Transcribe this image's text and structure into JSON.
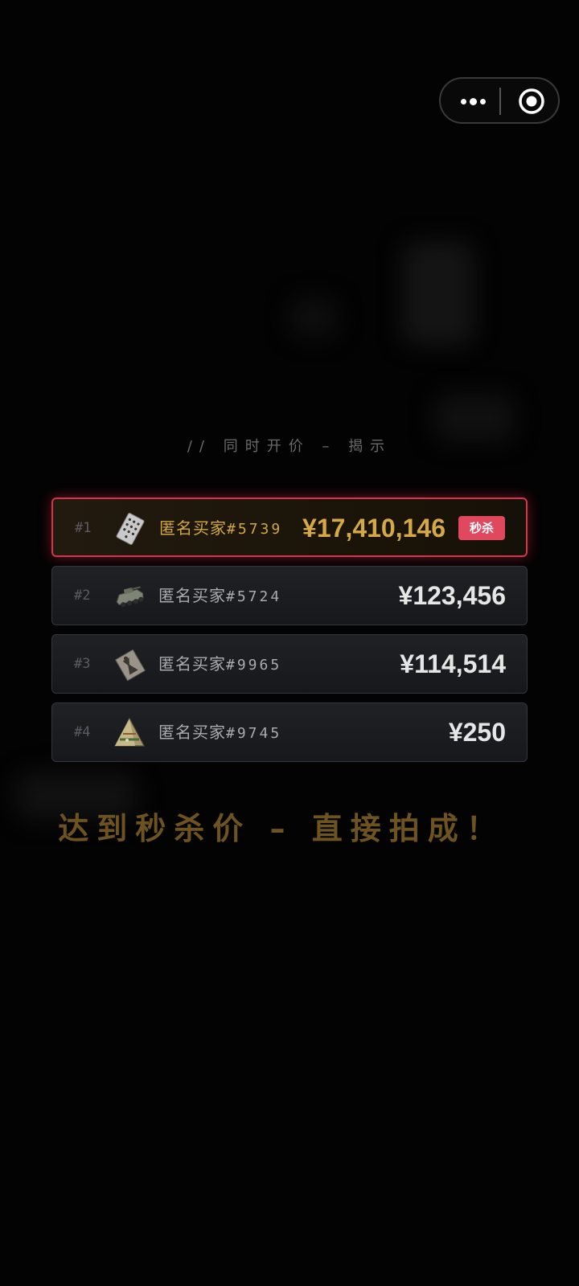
{
  "capsule": {
    "more_icon": "more-dots-icon",
    "close_icon": "target-close-icon"
  },
  "section": {
    "label": "// 同时开价 – 揭示"
  },
  "bids": [
    {
      "rank": "#1",
      "buyer_name": "匿名买家",
      "buyer_number": "#5739",
      "price": "¥17,410,146",
      "badge": "秒杀",
      "icon": "playing-card-icon"
    },
    {
      "rank": "#2",
      "buyer_name": "匿名买家",
      "buyer_number": "#5724",
      "price": "¥123,456",
      "icon": "armored-vehicle-icon"
    },
    {
      "rank": "#3",
      "buyer_name": "匿名买家",
      "buyer_number": "#9965",
      "price": "¥114,514",
      "icon": "poster-icon"
    },
    {
      "rank": "#4",
      "buyer_name": "匿名买家",
      "buyer_number": "#9745",
      "price": "¥250",
      "icon": "pyramid-icon"
    }
  ],
  "slogan": "达到秒杀价 – 直接拍成！",
  "colors": {
    "gold": "#d4a847",
    "badge_red": "#e0485e",
    "winner_border": "#d2364a"
  }
}
